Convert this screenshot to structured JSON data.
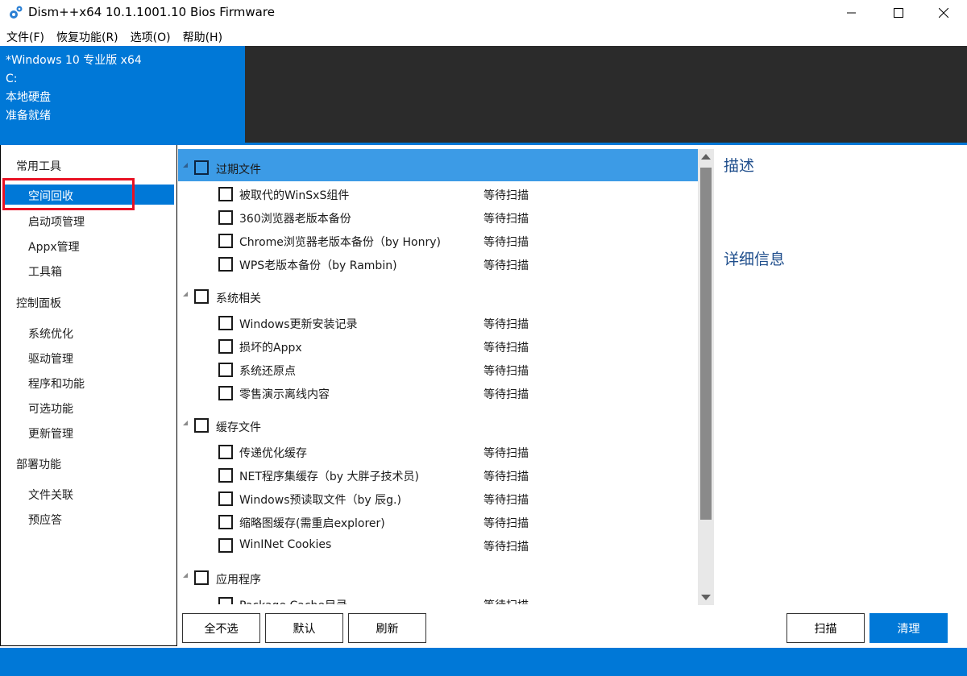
{
  "window": {
    "title": "Dism++x64 10.1.1001.10 Bios Firmware"
  },
  "menu": [
    "文件(F)",
    "恢复功能(R)",
    "选项(O)",
    "帮助(H)"
  ],
  "info": {
    "lines": [
      "*Windows 10 专业版 x64",
      "C:",
      "本地硬盘",
      "准备就绪"
    ]
  },
  "nav": {
    "sections": [
      {
        "header": "常用工具",
        "items": [
          "空间回收",
          "启动项管理",
          "Appx管理",
          "工具箱"
        ]
      },
      {
        "header": "控制面板",
        "items": [
          "系统优化",
          "驱动管理",
          "程序和功能",
          "可选功能",
          "更新管理"
        ]
      },
      {
        "header": "部署功能",
        "items": [
          "文件关联",
          "预应答"
        ]
      }
    ],
    "selected": "空间回收"
  },
  "groups": [
    {
      "label": "过期文件",
      "selected": true,
      "items": [
        {
          "label": "被取代的WinSxS组件",
          "status": "等待扫描"
        },
        {
          "label": "360浏览器老版本备份",
          "status": "等待扫描"
        },
        {
          "label": "Chrome浏览器老版本备份（by Honry)",
          "status": "等待扫描"
        },
        {
          "label": "WPS老版本备份（by Rambin)",
          "status": "等待扫描"
        }
      ]
    },
    {
      "label": "系统相关",
      "selected": false,
      "items": [
        {
          "label": "Windows更新安装记录",
          "status": "等待扫描"
        },
        {
          "label": "损坏的Appx",
          "status": "等待扫描"
        },
        {
          "label": "系统还原点",
          "status": "等待扫描"
        },
        {
          "label": "零售演示离线内容",
          "status": "等待扫描"
        }
      ]
    },
    {
      "label": "缓存文件",
      "selected": false,
      "items": [
        {
          "label": "传递优化缓存",
          "status": "等待扫描"
        },
        {
          "label": "NET程序集缓存（by 大胖子技术员)",
          "status": "等待扫描"
        },
        {
          "label": "Windows预读取文件（by 辰g.)",
          "status": "等待扫描"
        },
        {
          "label": "缩略图缓存(需重启explorer)",
          "status": "等待扫描"
        },
        {
          "label": "WinINet Cookies",
          "status": "等待扫描"
        }
      ]
    },
    {
      "label": "应用程序",
      "selected": false,
      "items": [
        {
          "label": "Package Cache目录",
          "status": "等待扫描"
        }
      ]
    }
  ],
  "right_panel": {
    "description_title": "描述",
    "details_title": "详细信息"
  },
  "buttons": {
    "deselect_all": "全不选",
    "default": "默认",
    "refresh": "刷新",
    "scan": "扫描",
    "clean": "清理"
  },
  "colors": {
    "accent": "#0078d7",
    "selected_row": "#3c9be6",
    "highlight_box": "#e81123",
    "dark_panel": "#2b2b2b"
  }
}
